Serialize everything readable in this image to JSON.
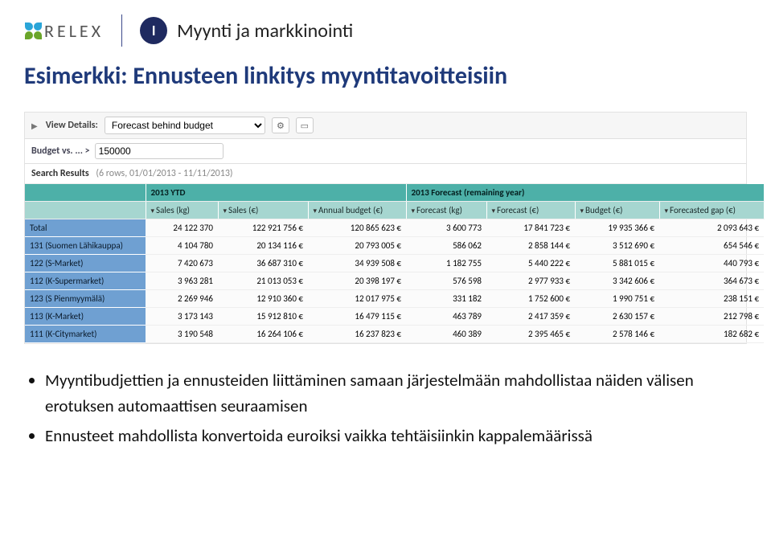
{
  "logo_text": "RELEX",
  "section_badge": "I",
  "section_label": "Myynti ja markkinointi",
  "page_title": "Esimerkki: Ennusteen linkitys myyntitavoitteisiin",
  "ui": {
    "view_details_label": "View Details:",
    "view_details_value": "Forecast behind budget",
    "gear_icon": "⚙",
    "window_icon": "▭",
    "filter_label": "Budget vs. ... >",
    "filter_value": "150000",
    "search_label": "Search Results",
    "search_meta": "(6 rows, 01/01/2013 - 11/11/2013)"
  },
  "table": {
    "groups": {
      "blank": "",
      "ytd": "2013 YTD",
      "forecast": "2013 Forecast (remaining year)"
    },
    "cols": {
      "sales_kg": "Sales (kg)",
      "sales_eur": "Sales (€)",
      "annual_budget": "Annual budget (€)",
      "forecast_kg": "Forecast (kg)",
      "forecast_eur": "Forecast (€)",
      "budget_eur": "Budget (€)",
      "forecast_gap": "Forecasted gap (€)"
    },
    "rows": [
      {
        "label": "Total",
        "sales_kg": "24 122 370",
        "sales_eur": "122 921 756 €",
        "annual_budget": "120 865 623 €",
        "forecast_kg": "3 600 773",
        "forecast_eur": "17 841 723 €",
        "budget_eur": "19 935 366 €",
        "forecast_gap": "2 093 643 €"
      },
      {
        "label": "131 (Suomen Lähikauppa)",
        "sales_kg": "4 104 780",
        "sales_eur": "20 134 116 €",
        "annual_budget": "20 793 005 €",
        "forecast_kg": "586 062",
        "forecast_eur": "2 858 144 €",
        "budget_eur": "3 512 690 €",
        "forecast_gap": "654 546 €"
      },
      {
        "label": "122 (S-Market)",
        "sales_kg": "7 420 673",
        "sales_eur": "36 687 310 €",
        "annual_budget": "34 939 508 €",
        "forecast_kg": "1 182 755",
        "forecast_eur": "5 440 222 €",
        "budget_eur": "5 881 015 €",
        "forecast_gap": "440 793 €"
      },
      {
        "label": "112 (K-Supermarket)",
        "sales_kg": "3 963 281",
        "sales_eur": "21 013 053 €",
        "annual_budget": "20 398 197 €",
        "forecast_kg": "576 598",
        "forecast_eur": "2 977 933 €",
        "budget_eur": "3 342 606 €",
        "forecast_gap": "364 673 €"
      },
      {
        "label": "123 (S Pienmyymälä)",
        "sales_kg": "2 269 946",
        "sales_eur": "12 910 360 €",
        "annual_budget": "12 017 975 €",
        "forecast_kg": "331 182",
        "forecast_eur": "1 752 600 €",
        "budget_eur": "1 990 751 €",
        "forecast_gap": "238 151 €"
      },
      {
        "label": "113 (K-Market)",
        "sales_kg": "3 173 143",
        "sales_eur": "15 912 810 €",
        "annual_budget": "16 479 115 €",
        "forecast_kg": "463 789",
        "forecast_eur": "2 417 359 €",
        "budget_eur": "2 630 157 €",
        "forecast_gap": "212 798 €"
      },
      {
        "label": "111 (K-Citymarket)",
        "sales_kg": "3 190 548",
        "sales_eur": "16 264 106 €",
        "annual_budget": "16 237 823 €",
        "forecast_kg": "460 389",
        "forecast_eur": "2 395 465 €",
        "budget_eur": "2 578 146 €",
        "forecast_gap": "182 682 €"
      }
    ]
  },
  "bullets": [
    "Myyntibudjettien ja ennusteiden liittäminen samaan järjestelmään mahdollistaa näiden välisen erotuksen automaattisen seuraamisen",
    "Ennusteet mahdollista konvertoida euroiksi vaikka tehtäisiinkin kappalemäärissä"
  ]
}
